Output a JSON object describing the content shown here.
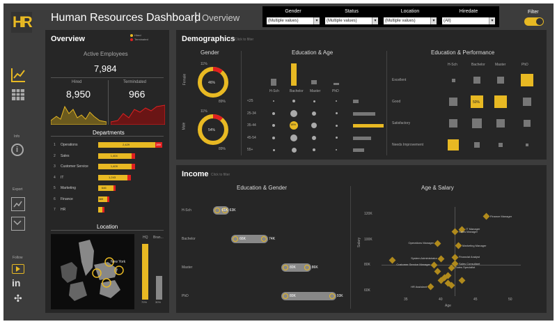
{
  "header": {
    "logo_text": "HR",
    "title": "Human Resources Dashboard",
    "separator": "|",
    "subtitle": "Overview",
    "filter_label": "Filter",
    "filters": [
      {
        "label": "Gender",
        "value": "(Multiple values)"
      },
      {
        "label": "Status",
        "value": "(Multiple values)"
      },
      {
        "label": "Location",
        "value": "(Multiple values)"
      },
      {
        "label": "Hiredate",
        "value": "(All)"
      }
    ]
  },
  "sidebar": {
    "info_label": "Info",
    "export_label": "Export",
    "follow_label": "Follow"
  },
  "overview": {
    "title": "Overview",
    "legend": [
      {
        "name": "Hired",
        "color": "#e8b923"
      },
      {
        "name": "Terminated",
        "color": "#e02020"
      }
    ],
    "active_label": "Active Employees",
    "active_value": "7,984",
    "hired_label": "Hired",
    "hired_value": "8,950",
    "term_label": "Termindated",
    "term_value": "966",
    "departments_title": "Departments",
    "departments": [
      {
        "rank": "1",
        "name": "Operations",
        "hired": "2,429",
        "term": "289",
        "hv": 2429,
        "tv": 289
      },
      {
        "rank": "2",
        "name": "Sales",
        "hired": "1,404",
        "term": "",
        "hv": 1404,
        "tv": 150
      },
      {
        "rank": "3",
        "name": "Customer Service",
        "hired": "1,409",
        "term": "",
        "hv": 1409,
        "tv": 160
      },
      {
        "rank": "4",
        "name": "IT",
        "hired": "1,243",
        "term": "",
        "hv": 1243,
        "tv": 140
      },
      {
        "rank": "5",
        "name": "Marketing",
        "hired": "646",
        "term": "",
        "hv": 646,
        "tv": 80
      },
      {
        "rank": "6",
        "name": "Finance",
        "hired": "389",
        "term": "",
        "hv": 389,
        "tv": 50
      },
      {
        "rank": "7",
        "name": "HR",
        "hired": "",
        "term": "",
        "hv": 170,
        "tv": 20
      }
    ],
    "location_title": "Location",
    "map_label": "New York",
    "hq_label": "HQ",
    "branch_label": "Bran...",
    "hq_pct": "70%",
    "branch_pct": "30%",
    "hq_value": 70,
    "branch_value": 30
  },
  "demographics": {
    "title": "Demographics",
    "hint": "Click to filter",
    "gender_title": "Gender",
    "female_label": "Female",
    "male_label": "Male",
    "female_center": "46%",
    "female_top": "11%",
    "female_bottom": "89%",
    "male_center": "54%",
    "male_top": "11%",
    "male_bottom": "89%",
    "female_value": 11,
    "male_value": 11,
    "edu_age_title": "Education & Age",
    "edu_cols": [
      "H-Sch",
      "Bachelor",
      "Master",
      "PhD"
    ],
    "age_rows": [
      "<25",
      "25-34",
      "35-44",
      "45-54",
      "55+"
    ],
    "highlight_label": "18%",
    "edu_perf_title": "Education & Performance",
    "perf_rows": [
      "Excellent",
      "Good",
      "Satisfactory",
      "Needs Improvement"
    ],
    "perf_cols": [
      "H-Sch",
      "Bachelor",
      "Master",
      "PhD"
    ],
    "perf_highlight": "50%"
  },
  "income": {
    "title": "Income",
    "hint": "Click to filter",
    "edu_gender_title": "Education & Gender",
    "rows": [
      {
        "label": "H-Sch",
        "left": "61K",
        "right": "63K"
      },
      {
        "label": "Bachelor",
        "left": "66K",
        "right": "74K"
      },
      {
        "label": "Master",
        "left": "80K",
        "right": "86K"
      },
      {
        "label": "PhD",
        "left": "80K",
        "right": "93K"
      }
    ],
    "age_salary_title": "Age & Salary",
    "y_axis_label": "Salary",
    "x_axis_label": "Age",
    "y_ticks": [
      "120K",
      "100K",
      "80K",
      "60K"
    ],
    "x_ticks": [
      "35",
      "40",
      "45",
      "50"
    ],
    "job_labels": [
      "Finance Manager",
      "IT Manager",
      "Sales Manager",
      "Operations Manager",
      "Marketing Manager",
      "Financial Analyst",
      "System Administrator",
      "Sales Consultant",
      "Customer Service Manager",
      "Sales Specialist",
      "HR Assistant"
    ]
  }
}
